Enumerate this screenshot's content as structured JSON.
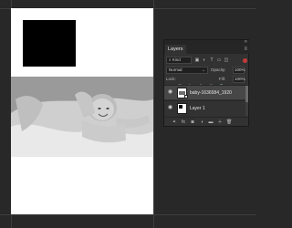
{
  "panel": {
    "tab_label": "Layers",
    "filter_kind": "Kind",
    "blend_mode": "Normal",
    "opacity_label": "Opacity:",
    "opacity_value": "100%",
    "lock_label": "Lock:",
    "fill_label": "Fill:",
    "fill_value": "100%"
  },
  "layers": [
    {
      "name": "baby-1636584_1920",
      "selected": true,
      "kind": "smart-object"
    },
    {
      "name": "Layer 1",
      "selected": false,
      "kind": "pixel"
    }
  ],
  "icons": {
    "eye": "eye-icon",
    "menu": "hamburger-menu-icon",
    "filter": "filter-icons"
  },
  "colors": {
    "workspace_bg": "#282828",
    "panel_bg": "#323232",
    "selected_row": "#474747",
    "filter_toggle": "#c33b3b"
  }
}
